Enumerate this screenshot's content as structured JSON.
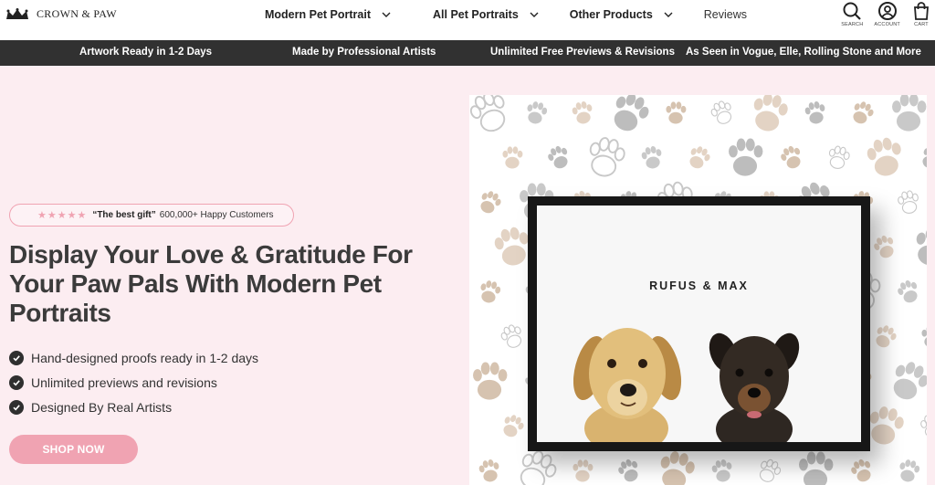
{
  "brand": {
    "name": "CROWN & PAW",
    "logo_icon": "crown-icon"
  },
  "nav": {
    "items": [
      {
        "label": "Modern Pet Portrait",
        "has_dropdown": true
      },
      {
        "label": "All Pet Portraits",
        "has_dropdown": true
      },
      {
        "label": "Other Products",
        "has_dropdown": true
      },
      {
        "label": "Reviews",
        "has_dropdown": false
      }
    ]
  },
  "utilities": {
    "search": {
      "label": "SEARCH",
      "icon": "search-icon"
    },
    "account": {
      "label": "ACCOUNT",
      "icon": "account-icon"
    },
    "cart": {
      "label": "CART",
      "icon": "cart-icon"
    }
  },
  "announcement_bar": {
    "items": [
      "Artwork Ready in 1-2 Days",
      "Made by Professional Artists",
      "Unlimited Free Previews & Revisions",
      "As Seen in Vogue, Elle, Rolling Stone and More"
    ]
  },
  "hero": {
    "review": {
      "stars": "★★★★★",
      "quote": "“The best gift”",
      "count": "600,000+ Happy Customers"
    },
    "headline": "Display Your Love & Gratitude For Your Paw Pals With Modern Pet Portraits",
    "features": [
      "Hand-designed proofs ready in 1-2 days",
      "Unlimited previews and revisions",
      "Designed By Real Artists"
    ],
    "cta": "SHOP NOW",
    "portrait": {
      "names": "RUFUS & MAX"
    }
  },
  "colors": {
    "hero_bg": "#fcedf1",
    "accent_pink": "#f0a3b2",
    "bar_bg": "#313131",
    "text_dark": "#3b3b3b"
  }
}
